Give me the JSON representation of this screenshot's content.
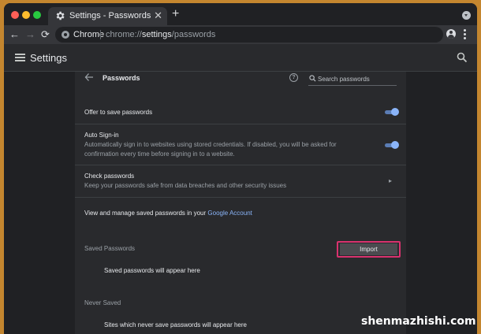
{
  "tab": {
    "title": "Settings - Passwords",
    "close": "✕",
    "new_tab": "+"
  },
  "toolbar": {
    "back": "←",
    "forward": "→",
    "reload": "⟳",
    "site_chip": "Chrome",
    "url_scheme": "chrome://",
    "url_host": "settings",
    "url_path": "/passwords",
    "star": "☆"
  },
  "settings": {
    "title": "Settings"
  },
  "passwords": {
    "title": "Passwords",
    "help": "?",
    "search_placeholder": "Search passwords",
    "offer_to_save": {
      "label": "Offer to save passwords",
      "enabled": true
    },
    "auto_signin": {
      "label": "Auto Sign-in",
      "description": "Automatically sign in to websites using stored credentials. If disabled, you will be asked for confirmation every time before signing in to a website.",
      "enabled": true
    },
    "check": {
      "label": "Check passwords",
      "description": "Keep your passwords safe from data breaches and other security issues",
      "chevron": "▸"
    },
    "manage": {
      "text": "View and manage saved passwords in your ",
      "link": "Google Account"
    },
    "saved": {
      "label": "Saved Passwords",
      "import_label": "Import",
      "empty": "Saved passwords will appear here"
    },
    "never_saved": {
      "label": "Never Saved",
      "empty": "Sites which never save passwords will appear here"
    }
  },
  "watermark": "shenmazhishi.com",
  "colors": {
    "accent": "#8ab4f8",
    "highlight": "#d8326e",
    "background": "#292a2d"
  }
}
